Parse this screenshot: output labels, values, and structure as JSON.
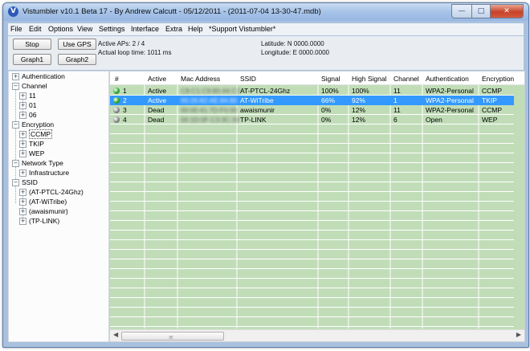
{
  "window": {
    "title": "Vistumbler v10.1 Beta 17 - By Andrew Calcutt - 05/12/2011 - (2011-07-04 13-30-47.mdb)",
    "icon": "vistumbler-app-icon"
  },
  "menu": [
    "File",
    "Edit",
    "Options",
    "View",
    "Settings",
    "Interface",
    "Extra",
    "Help",
    "*Support Vistumbler*"
  ],
  "toolbar": {
    "stop": "Stop",
    "use_gps": "Use GPS",
    "graph1": "Graph1",
    "graph2": "Graph2",
    "active_aps": "Active APs: 2 / 4",
    "loop_time": "Actual loop time: 1011 ms",
    "latitude": "Latitude: N 0000.0000",
    "longitude": "Longitude: E 0000.0000"
  },
  "tree": {
    "authentication": "Authentication",
    "channel": "Channel",
    "channel_items": [
      "11",
      "01",
      "06"
    ],
    "encryption": "Encryption",
    "encryption_items": [
      "CCMP",
      "TKIP",
      "WEP"
    ],
    "network_type": "Network Type",
    "network_type_items": [
      "Infrastructure"
    ],
    "ssid": "SSID",
    "ssid_items": [
      "(AT-PTCL-24Ghz)",
      "(AT-WiTribe)",
      "(awaismunir)",
      "(TP-LINK)"
    ]
  },
  "table": {
    "columns": [
      "#",
      "Active",
      "Mac Address",
      "SSID",
      "Signal",
      "High Signal",
      "Channel",
      "Authentication",
      "Encryption"
    ],
    "rows": [
      {
        "num": "1",
        "active": "Active",
        "mac": "C8:C1:C9:80:44:C2",
        "ssid": "AT-PTCL-24Ghz",
        "signal": "100%",
        "high": "100%",
        "channel": "11",
        "auth": "WPA2-Personal",
        "enc": "CCMP",
        "status_color": "#2eaa2e"
      },
      {
        "num": "2",
        "active": "Active",
        "mac": "00:26:82:AE:84:80",
        "ssid": "AT-WiTribe",
        "signal": "66%",
        "high": "92%",
        "channel": "1",
        "auth": "WPA2-Personal",
        "enc": "TKIP",
        "status_color": "#2eaa2e"
      },
      {
        "num": "3",
        "active": "Dead",
        "mac": "00:00:41:7D:F0:00",
        "ssid": "awaismunir",
        "signal": "0%",
        "high": "12%",
        "channel": "11",
        "auth": "WPA2-Personal",
        "enc": "CCMP",
        "status_color": "#8a8a8a"
      },
      {
        "num": "4",
        "active": "Dead",
        "mac": "00:1D:0F:C3:3C:33",
        "ssid": "TP-LINK",
        "signal": "0%",
        "high": "12%",
        "channel": "6",
        "auth": "Open",
        "enc": "WEP",
        "status_color": "#8a8a8a"
      }
    ],
    "selected_row": 1
  },
  "colors": {
    "list_background": "#c1ddb8",
    "selection": "#3399ff",
    "window_frame": "#a9c1df"
  }
}
